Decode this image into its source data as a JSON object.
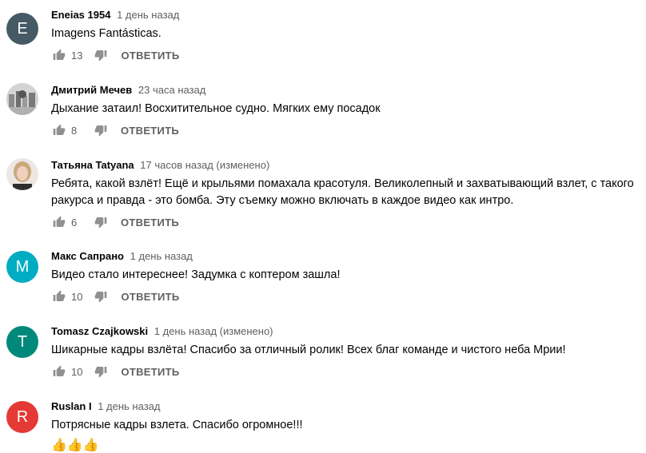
{
  "reply_label": "ОТВЕТИТЬ",
  "colors": {
    "e": "#455a64",
    "m": "#00acc1",
    "t": "#00897b",
    "r": "#e53935"
  },
  "comments": [
    {
      "initial": "E",
      "author": "Eneias 1954",
      "time": "1 день назад",
      "text": "Imagens Fantásticas.",
      "likes": "13"
    },
    {
      "initial": "",
      "author": "Дмитрий Мечев",
      "time": "23 часа назад",
      "text": "Дыхание затаил! Восхитительное судно. Мягких ему посадок",
      "likes": "8"
    },
    {
      "initial": "",
      "author": "Татьяна Tatyana",
      "time": "17 часов назад (изменено)",
      "text": "Ребята, какой взлёт! Ещё и крыльями помахала красотуля. Великолепный и захватывающий взлет, с такого ракурса и правда - это бомба. Эту съемку можно включать в  каждое видео как интро.",
      "likes": "6"
    },
    {
      "initial": "M",
      "author": "Макс Сапрано",
      "time": "1 день назад",
      "text": "Видео стало интереснее! Задумка с коптером зашла!",
      "likes": "10"
    },
    {
      "initial": "T",
      "author": "Tomasz Czajkowski",
      "time": "1 день назад (изменено)",
      "text": "Шикарные кадры взлёта! Спасибо за отличный ролик! Всех благ команде и чистого неба Мрии!",
      "likes": "10"
    },
    {
      "initial": "R",
      "author": "Ruslan I",
      "time": "1 день назад",
      "text": "Потрясные кадры взлета. Спасибо огромное!!!",
      "emoji": "👍👍👍"
    }
  ]
}
